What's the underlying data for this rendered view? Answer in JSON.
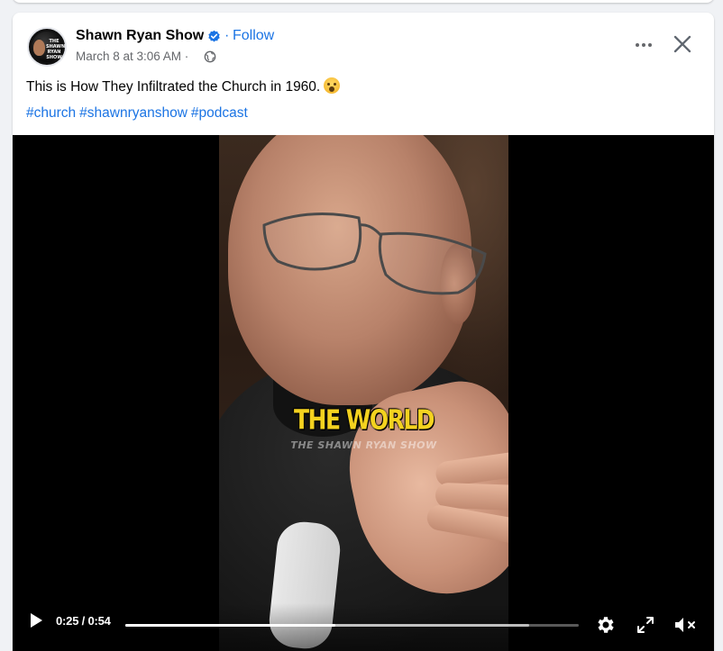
{
  "post": {
    "page_name": "Shawn Ryan Show",
    "follow_label": "Follow",
    "separator": "·",
    "timestamp": "March 8 at 3:06 AM · ",
    "avatar_text": "THE SHAWN RYAN SHOW",
    "caption": "This is How They Infiltrated the Church in 1960.",
    "caption_emoji": "astonished-face-emoji",
    "hashtags": [
      "#church",
      "#shawnryanshow",
      "#podcast"
    ]
  },
  "video": {
    "subtitle": "THE WORLD",
    "watermark": "THE SHAWN RYAN SHOW",
    "time_display": "0:25 / 0:54",
    "progress_fraction": 0.463,
    "buffered_fraction": 0.89
  },
  "icons": {
    "verified": "verified-badge-icon",
    "audience": "globe-icon",
    "more": "more-options-icon",
    "close": "close-icon",
    "play": "play-icon",
    "settings": "gear-icon",
    "fullscreen": "fullscreen-icon",
    "mute": "muted-speaker-icon"
  },
  "colors": {
    "link_blue": "#1b74e4",
    "secondary_text": "#65676b",
    "subtitle_yellow": "#f4d21f"
  }
}
